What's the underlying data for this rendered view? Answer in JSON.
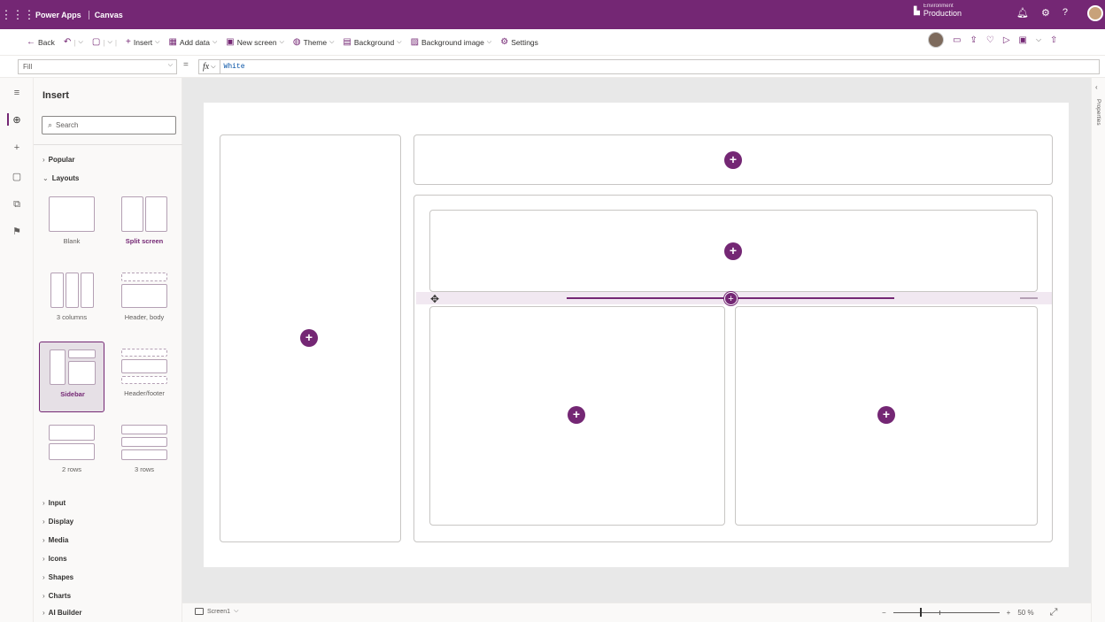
{
  "header": {
    "app_name": "Power Apps",
    "app_type": "Canvas",
    "environment_label": "Environment",
    "environment_name": "Production"
  },
  "command_bar": {
    "back": "Back",
    "insert": "Insert",
    "add_data": "Add data",
    "new_screen": "New screen",
    "theme": "Theme",
    "background": "Background",
    "background_image": "Background image",
    "settings": "Settings"
  },
  "formula_bar": {
    "property": "Fill",
    "fx": "fx",
    "value": "White"
  },
  "insert_pane": {
    "title": "Insert",
    "search_placeholder": "Search",
    "categories_top": [
      "Popular",
      "Layouts"
    ],
    "layouts": [
      {
        "label": "Blank"
      },
      {
        "label": "Split screen"
      },
      {
        "label": "3 columns"
      },
      {
        "label": "Header, body"
      },
      {
        "label": "Sidebar"
      },
      {
        "label": "Header/footer"
      },
      {
        "label": "2 rows"
      },
      {
        "label": "3 rows"
      }
    ],
    "categories_bottom": [
      "Input",
      "Display",
      "Media",
      "Icons",
      "Shapes",
      "Charts",
      "AI Builder"
    ]
  },
  "right_rail": {
    "label": "Properties"
  },
  "bottom_bar": {
    "screen_name": "Screen1",
    "zoom_label": "50 %"
  },
  "colors": {
    "brand": "#742774",
    "canvas_bg": "#e8e8e8"
  }
}
